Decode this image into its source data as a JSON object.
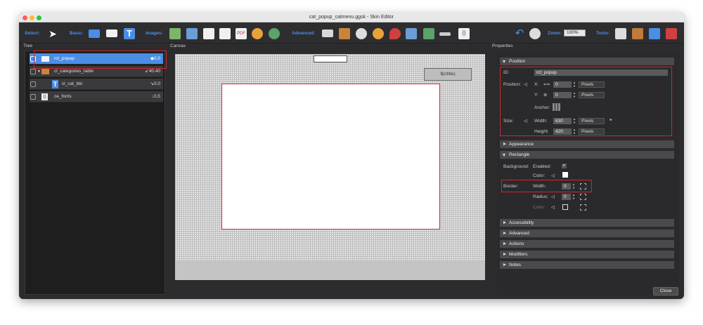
{
  "window": {
    "title": "cat_popup_catmenu.ggsk - Skin Editor"
  },
  "toolbar": {
    "select_label": "Select:",
    "basic_label": "Basic:",
    "images_label": "Images:",
    "advanced_label": "Advanced:",
    "zoom_label": "Zoom:",
    "zoom_value": "100%",
    "tools_label": "Tools:"
  },
  "panels": {
    "tree": "Tree",
    "canvas": "Canvas",
    "properties": "Properties"
  },
  "tree": {
    "rows": [
      {
        "name": "rct_popup",
        "value": "◆0,0"
      },
      {
        "name": "cl_categories_table",
        "value": "↙40,40"
      },
      {
        "name": "cl_cat_btn",
        "value": "↘0,0"
      },
      {
        "name": "ce_fonts",
        "value": "↓0,5"
      }
    ]
  },
  "canvas": {
    "element_text": "$(ctitle)"
  },
  "properties": {
    "sections": {
      "position": "Position",
      "appearance": "Appearance",
      "rectangle": "Rectangle",
      "accessibility": "Accessibility",
      "advanced": "Advanced",
      "actions": "Actions",
      "modifiers": "Modifiers",
      "notes": "Notes"
    },
    "id_label": "ID:",
    "id_value": "rct_popup",
    "position_label": "Position:",
    "x_label": "X:",
    "x_value": "0",
    "x_unit": "Pixels",
    "y_label": "Y:",
    "y_value": "0",
    "y_unit": "Pixels",
    "anchor_label": "Anchor:",
    "size_label": "Size:",
    "width_label": "Width:",
    "width_value": "630",
    "width_unit": "Pixels",
    "height_label": "Height:",
    "height_value": "420",
    "height_unit": "Pixels",
    "background_label": "Background:",
    "enabled_label": "Enabled:",
    "enabled_check": "✔",
    "color_label": "Color:",
    "border_label": "Border:",
    "border_width_label": "Width:",
    "border_width_value": "0",
    "radius_label": "Radius:",
    "radius_value": "0",
    "border_color_label": "Color:"
  },
  "footer": {
    "close_label": "Close"
  }
}
